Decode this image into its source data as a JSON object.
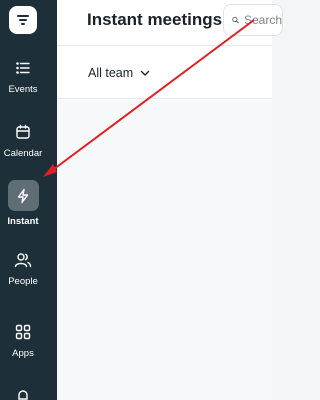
{
  "sidebar": {
    "items": [
      {
        "label": "Events",
        "icon": "list-icon"
      },
      {
        "label": "Calendar",
        "icon": "calendar-icon"
      },
      {
        "label": "Instant",
        "icon": "lightning-icon",
        "active": true
      },
      {
        "label": "People",
        "icon": "people-icon"
      },
      {
        "label": "Apps",
        "icon": "grid-icon"
      },
      {
        "label": "",
        "icon": "bell-icon"
      }
    ]
  },
  "header": {
    "title": "Instant meetings",
    "search_placeholder": "Search"
  },
  "filter": {
    "team_label": "All team"
  },
  "colors": {
    "sidebar_bg": "#1d2f38",
    "active_item_bg": "#5f6e75",
    "annotation_arrow": "#e02020"
  }
}
